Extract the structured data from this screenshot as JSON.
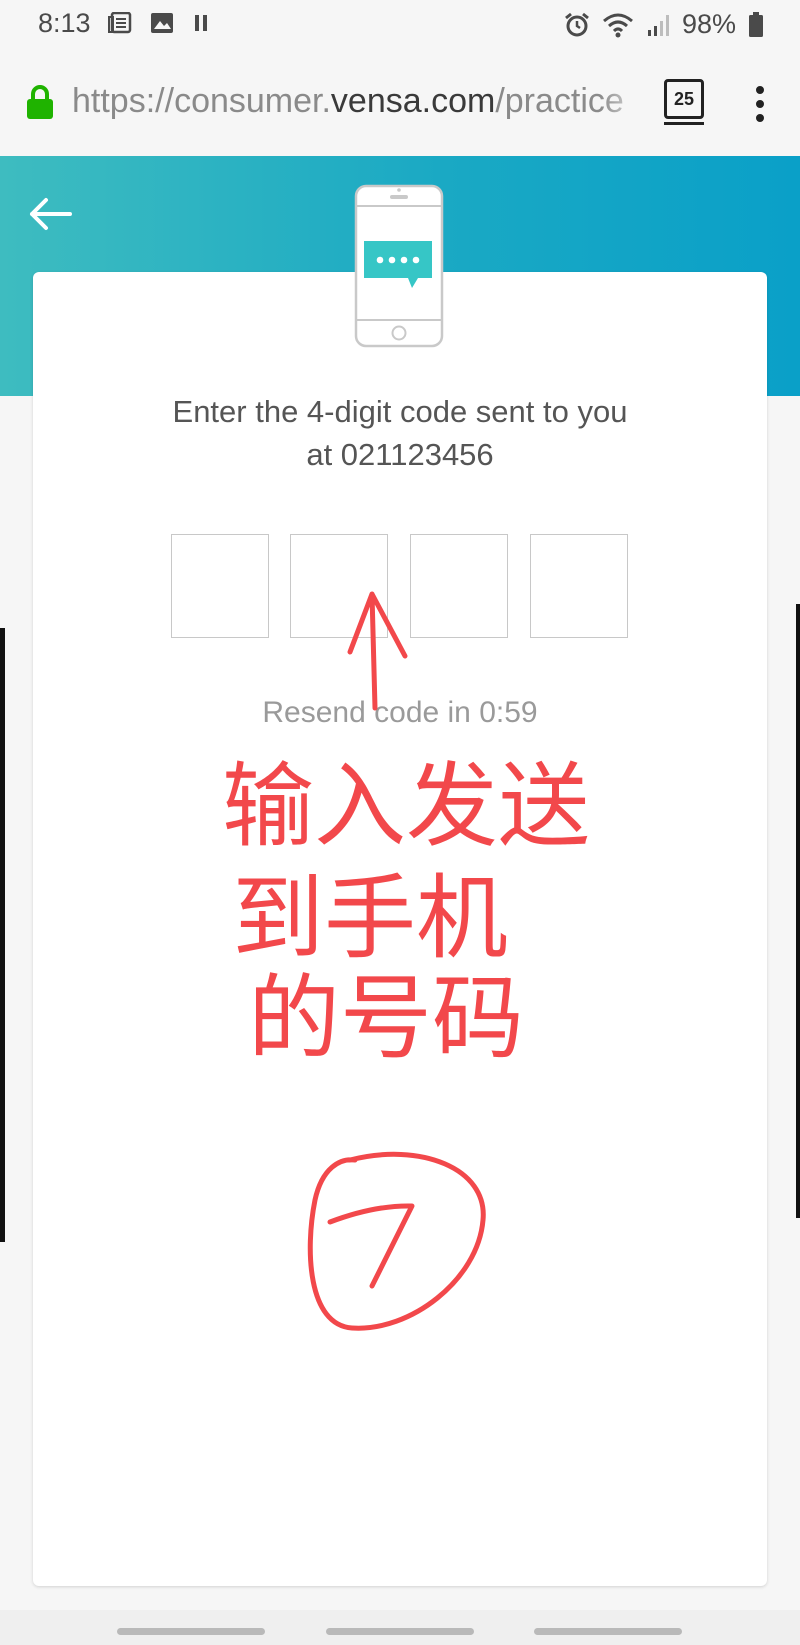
{
  "status_bar": {
    "time": "8:13",
    "left_icons": [
      "news-icon",
      "image-icon",
      "pause-icon"
    ],
    "right_icons": [
      "alarm-icon",
      "wifi-icon",
      "signal-icon",
      "battery-icon"
    ],
    "battery": "98%"
  },
  "browser": {
    "url_scheme": "https://",
    "url_subdomain": "consumer.",
    "url_host": "vensa.com",
    "url_path": "/practice",
    "tab_count": "25",
    "secure_color": "#1fb300"
  },
  "header": {
    "background_color": "#1aa9c4"
  },
  "verification": {
    "instruction_line1": "Enter the 4-digit code sent to you",
    "instruction_line2": "at 021123456",
    "code_digits": [
      "",
      "",
      "",
      ""
    ],
    "resend_text": "Resend code in 0:59"
  },
  "annotation": {
    "text_line1": "输入发送",
    "text_line2": "到手机",
    "text_line3": "的号码",
    "step_number": "7",
    "color": "#f2484b"
  }
}
